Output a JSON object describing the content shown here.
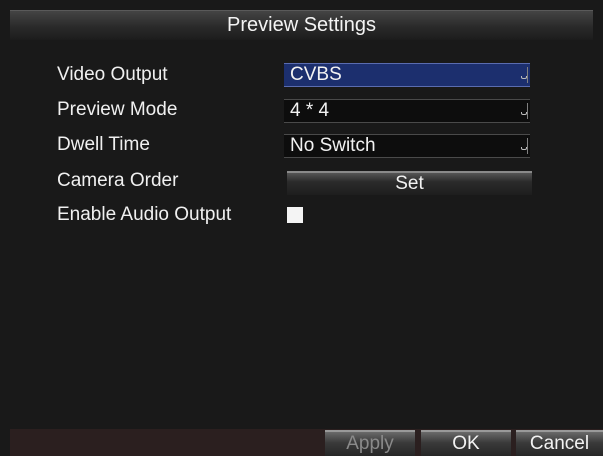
{
  "title": "Preview Settings",
  "rows": [
    {
      "label": "Video Output",
      "value": "CVBS"
    },
    {
      "label": "Preview Mode",
      "value": "4 * 4"
    },
    {
      "label": "Dwell Time",
      "value": "No Switch"
    },
    {
      "label": "Camera Order",
      "value": "Set"
    },
    {
      "label": "Enable Audio Output",
      "checked": false
    }
  ],
  "footer": {
    "apply": "Apply",
    "ok": "OK",
    "cancel": "Cancel"
  },
  "colors": {
    "background": "#191919",
    "highlight": "#1c2f6e",
    "footer": "#2b1f1f"
  }
}
